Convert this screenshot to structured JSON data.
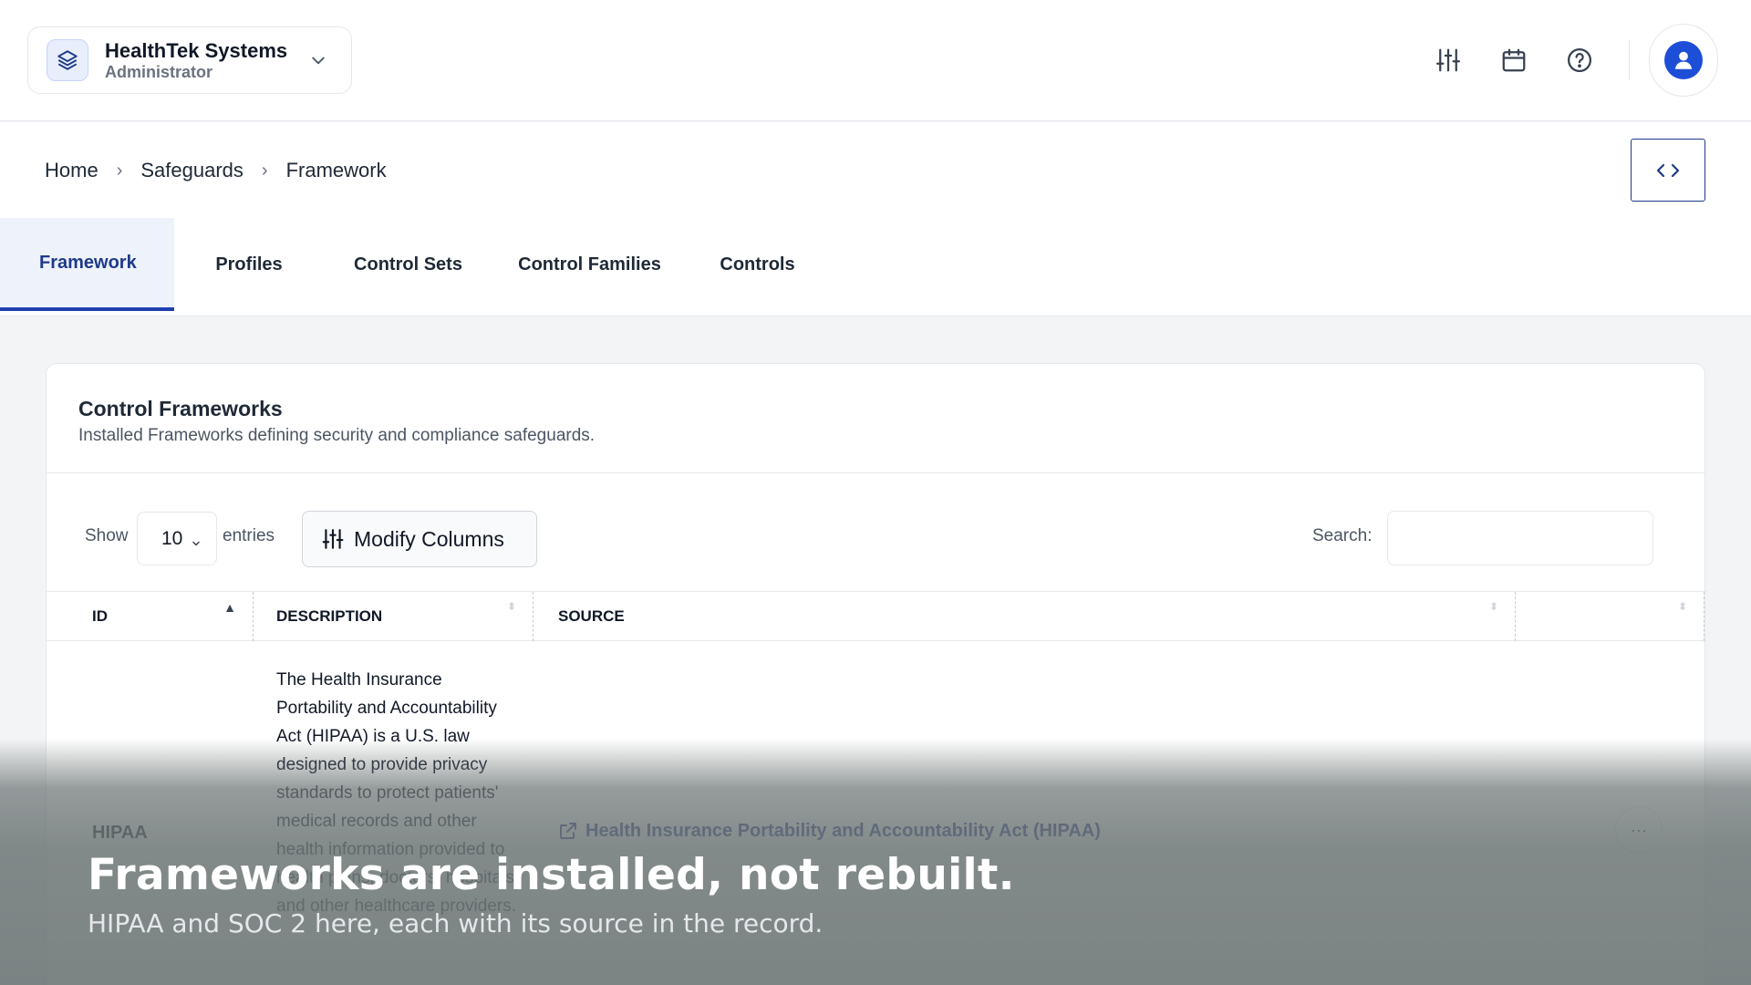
{
  "org": {
    "name": "HealthTek Systems",
    "role": "Administrator"
  },
  "header_icons": [
    "sliders-icon",
    "calendar-icon",
    "help-icon",
    "user-avatar-icon"
  ],
  "breadcrumb": [
    "Home",
    "Safeguards",
    "Framework"
  ],
  "tabs": [
    {
      "label": "Framework",
      "active": true
    },
    {
      "label": "Profiles",
      "active": false
    },
    {
      "label": "Control Sets",
      "active": false
    },
    {
      "label": "Control Families",
      "active": false
    },
    {
      "label": "Controls",
      "active": false
    }
  ],
  "card": {
    "title": "Control Frameworks",
    "subtitle": "Installed Frameworks defining security and compliance safeguards."
  },
  "table_controls": {
    "show_label": "Show",
    "page_length": "10",
    "entries_label": "entries",
    "modify_columns_label": "Modify Columns",
    "search_label": "Search:",
    "search_value": ""
  },
  "columns": [
    "ID",
    "DESCRIPTION",
    "SOURCE",
    ""
  ],
  "rows": [
    {
      "id": "HIPAA",
      "description": "The Health Insurance Portability and Accountability Act (HIPAA) is a U.S. law designed to provide privacy standards to protect patients' medical records and other health information provided to health plans, doctors, hospitals, and other healthcare providers.",
      "source": "Health Insurance Portability and Accountability Act (HIPAA)",
      "actions": "···"
    }
  ],
  "caption": {
    "title": "Frameworks are installed, not rebuilt.",
    "subtitle": "HIPAA and SOC 2 here, each with its source in the record."
  },
  "colors": {
    "accent": "#1e3a8a",
    "tab_active_bg": "#eef2fb",
    "avatar": "#1d4ed8"
  }
}
